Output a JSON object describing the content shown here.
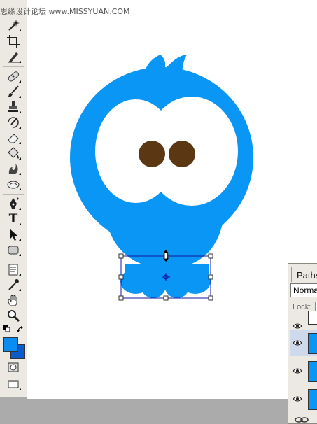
{
  "watermark": "思缘设计论坛 www.MISSYUAN.COM",
  "colors": {
    "bird_blue": "#0a96f5",
    "eye_white": "#ffffff",
    "pupil_brown": "#5b3714",
    "transform_box": "#1414a0",
    "foreground": "#0a8cf0",
    "background": "#0a5ccc"
  },
  "toolbox": {
    "tools": [
      {
        "name": "magic-wand-icon"
      },
      {
        "name": "crop-icon"
      },
      {
        "name": "slice-icon"
      },
      {
        "name": "healing-brush-icon"
      },
      {
        "name": "brush-icon"
      },
      {
        "name": "clone-stamp-icon"
      },
      {
        "name": "history-brush-icon"
      },
      {
        "name": "eraser-icon"
      },
      {
        "name": "paint-bucket-icon"
      },
      {
        "name": "burn-icon"
      },
      {
        "name": "smudge-icon"
      },
      {
        "name": "pen-icon"
      },
      {
        "name": "type-icon",
        "label": "T"
      },
      {
        "name": "path-selection-icon"
      },
      {
        "name": "rounded-rectangle-icon"
      },
      {
        "name": "notes-icon"
      },
      {
        "name": "eyedropper-icon"
      },
      {
        "name": "hand-icon"
      },
      {
        "name": "zoom-icon"
      },
      {
        "name": "quick-mask-icon"
      },
      {
        "name": "screen-mode-icon"
      }
    ]
  },
  "panel": {
    "tab_label": "Paths",
    "blend_mode": "Normal",
    "lock_label": "Lock:",
    "layers": [
      {
        "visible": true,
        "selected": false
      },
      {
        "visible": true,
        "selected": true
      },
      {
        "visible": true,
        "selected": false
      },
      {
        "visible": true,
        "selected": false
      }
    ]
  }
}
